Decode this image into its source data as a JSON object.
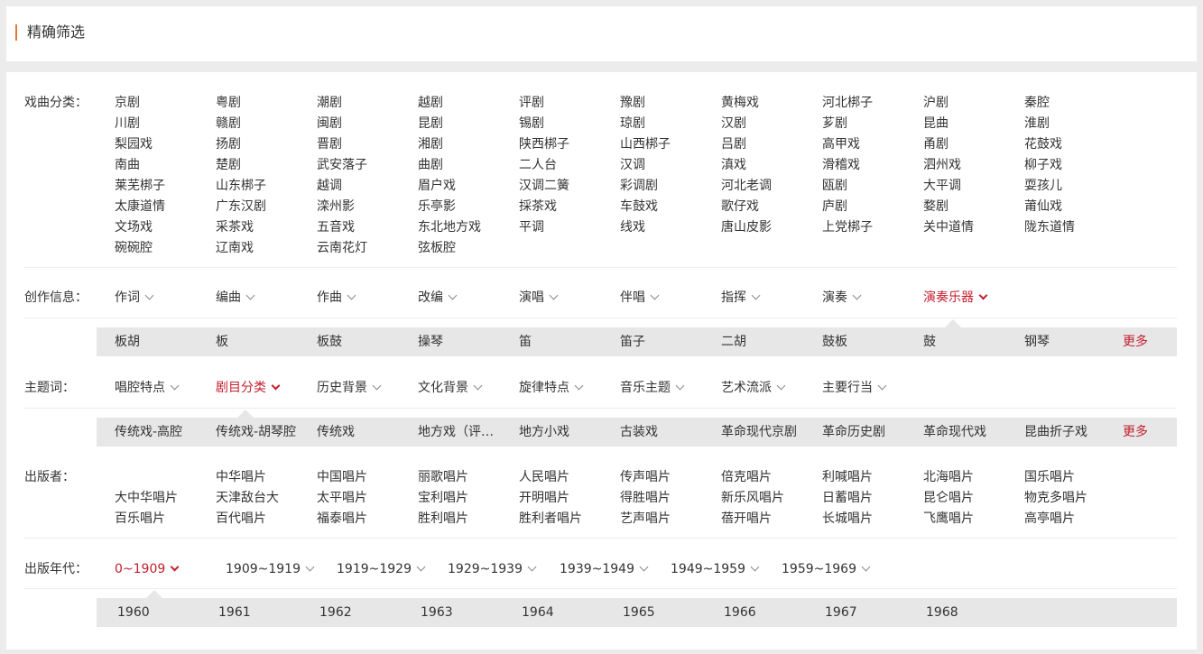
{
  "header": {
    "title": "精确筛选"
  },
  "opera": {
    "label": "戏曲分类：",
    "rows": [
      [
        "京剧",
        "粤剧",
        "潮剧",
        "越剧",
        "评剧",
        "豫剧",
        "黄梅戏",
        "河北梆子",
        "沪剧",
        "秦腔"
      ],
      [
        "川剧",
        "赣剧",
        "闽剧",
        "昆剧",
        "锡剧",
        "琼剧",
        "汉剧",
        "芗剧",
        "昆曲",
        "淮剧"
      ],
      [
        "梨园戏",
        "扬剧",
        "晋剧",
        "湘剧",
        "陕西梆子",
        "山西梆子",
        "吕剧",
        "高甲戏",
        "甬剧",
        "花鼓戏"
      ],
      [
        "南曲",
        "楚剧",
        "武安落子",
        "曲剧",
        "二人台",
        "汉调",
        "滇戏",
        "滑稽戏",
        "泗州戏",
        "柳子戏"
      ],
      [
        "莱芜梆子",
        "山东梆子",
        "越调",
        "眉户戏",
        "汉调二簧",
        "彩调剧",
        "河北老调",
        "瓯剧",
        "大平调",
        "耍孩儿"
      ],
      [
        "太康道情",
        "广东汉剧",
        "滦州影",
        "乐亭影",
        "採茶戏",
        "车鼓戏",
        "歌仔戏",
        "庐剧",
        "婺剧",
        "莆仙戏"
      ],
      [
        "文场戏",
        "采茶戏",
        "五音戏",
        "东北地方戏",
        "平调",
        "线戏",
        "唐山皮影",
        "上党梆子",
        "关中道情",
        "陇东道情"
      ],
      [
        "碗碗腔",
        "辽南戏",
        "云南花灯",
        "弦板腔"
      ]
    ]
  },
  "creation": {
    "label": "创作信息：",
    "items": [
      "作词",
      "编曲",
      "作曲",
      "改编",
      "演唱",
      "伴唱",
      "指挥",
      "演奏",
      "演奏乐器"
    ],
    "sub": [
      "板胡",
      "板",
      "板鼓",
      "操琴",
      "笛",
      "笛子",
      "二胡",
      "鼓板",
      "鼓",
      "钢琴"
    ],
    "more": "更多"
  },
  "theme": {
    "label": "主题词：",
    "items": [
      "唱腔特点",
      "剧目分类",
      "历史背景",
      "文化背景",
      "旋律特点",
      "音乐主题",
      "艺术流派",
      "主要行当"
    ],
    "sub": [
      "传统戏-高腔",
      "传统戏-胡琴腔",
      "传统戏",
      "地方戏（评剧）",
      "地方小戏",
      "古装戏",
      "革命现代京剧",
      "革命历史剧",
      "革命现代戏",
      "昆曲折子戏"
    ],
    "more": "更多"
  },
  "publisher": {
    "label": "出版者：",
    "rows": [
      [
        "",
        "中华唱片",
        "中国唱片",
        "丽歌唱片",
        "人民唱片",
        "传声唱片",
        "倍克唱片",
        "利喊唱片",
        "北海唱片",
        "国乐唱片"
      ],
      [
        "大中华唱片",
        "天津敌台大",
        "太平唱片",
        "宝利唱片",
        "开明唱片",
        "得胜唱片",
        "新乐风唱片",
        "日蓄唱片",
        "昆仑唱片",
        "物克多唱片"
      ],
      [
        "百乐唱片",
        "百代唱片",
        "福泰唱片",
        "胜利唱片",
        "胜利者唱片",
        "艺声唱片",
        "蓓开唱片",
        "长城唱片",
        "飞鹰唱片",
        "高亭唱片"
      ]
    ]
  },
  "year": {
    "label": "出版年代：",
    "items": [
      "0~1909",
      "1909~1919",
      "1919~1929",
      "1929~1939",
      "1939~1949",
      "1949~1959",
      "1959~1969"
    ],
    "sub": [
      "1960",
      "1961",
      "1962",
      "1963",
      "1964",
      "1965",
      "1966",
      "1967",
      "1968"
    ]
  },
  "colors": {
    "accent": "#c31f2e",
    "header_bar": "#e8772e",
    "subbar": "#e7e7e7"
  }
}
